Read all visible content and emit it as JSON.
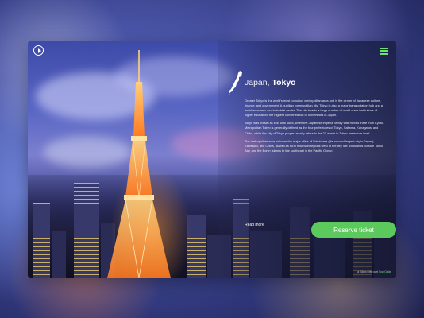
{
  "nav": {
    "play_icon": "play-circle-icon",
    "menu_icon": "hamburger-menu-icon"
  },
  "header": {
    "title_light": "Japan, ",
    "title_bold": "Tokyo"
  },
  "content": {
    "paragraphs": [
      "Greater Tokyo is the world's most populous metropolitan area and is the center of Japanese culture, finance, and government. A bustling cosmopolitan city, Tokyo is also a major transportation hub and a world economic and industrial center. The city boasts a large number of world-class institutions of higher education, the highest concentration of universities in Japan.",
      "Tokyo was known as Edo until 1868, when the Japanese imperial family was moved there from Kyoto. Metropolitan Tokyo is generally defined as the four prefectures of Tokyo, Saitama, Kanagawa, and Chiba, while the city of Tokyo proper usually refers to the 23 wards in Tokyo prefecture itself.",
      "The metropolitan area includes the major cities of Yokohama (the second largest city in Japan), Kawasaki, and Chiba, as well as rural mountain regions west of the city, the Izu Islands outside Tokyo Bay, and the Bonin Islands to the southeast in the Pacific Ocean."
    ],
    "read_more": "Read more"
  },
  "actions": {
    "reserve_label": "Reserve ticket"
  },
  "footer": {
    "credit_prefix": "a Tokyo write part ",
    "credit_accent": "Tour Guide"
  },
  "colors": {
    "accent_green": "#5bc95b"
  }
}
